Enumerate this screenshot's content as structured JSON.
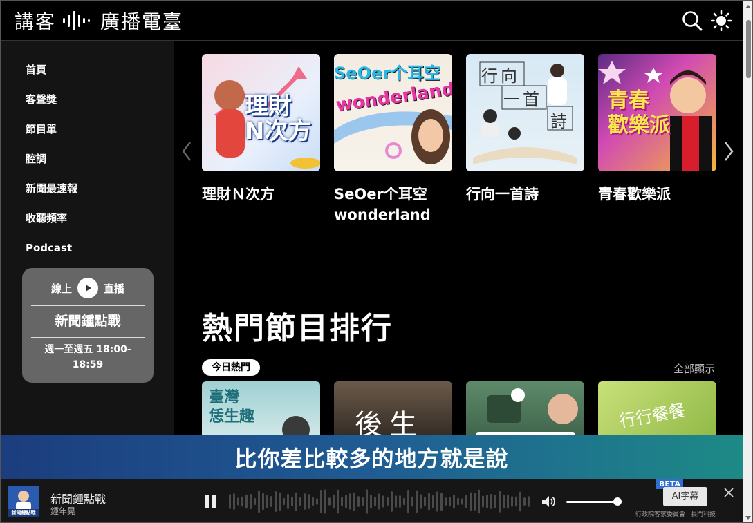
{
  "header": {
    "logo_left": "講客",
    "logo_right": "廣播電臺"
  },
  "sidebar": {
    "items": [
      {
        "label": "首頁"
      },
      {
        "label": "客聲獎"
      },
      {
        "label": "節目單"
      },
      {
        "label": "腔調"
      },
      {
        "label": "新聞最速報"
      },
      {
        "label": "收聽頻率"
      },
      {
        "label": "Podcast"
      }
    ],
    "live": {
      "left": "線上",
      "right": "直播",
      "show": "新聞鍾點戰",
      "time": "週一至週五 18:00-18:59"
    }
  },
  "carousel": {
    "items": [
      {
        "title": "理財Ｎ次方",
        "art": "理財\nN次方"
      },
      {
        "title": "SeOer个耳空 wonderland",
        "art_a": "SeOer个耳空",
        "art_b": "wonderland"
      },
      {
        "title": "行向一首詩",
        "art_a": "行向",
        "art_b": "一首",
        "art_c": "詩"
      },
      {
        "title": "青春歡樂派",
        "art": "青春\n歡樂派"
      }
    ]
  },
  "hot": {
    "title": "熱門節目排行",
    "tab": "今日熱門",
    "show_all": "全部顯示",
    "items": [
      {
        "art": "臺灣\n恁生趣"
      },
      {
        "art": "後生"
      },
      {
        "art": ""
      },
      {
        "art": "行行餐餐"
      }
    ]
  },
  "subtitle": "比你差比較多的地方就是說",
  "player": {
    "show": "新聞鍾點戰",
    "host": "鍾年晃",
    "thumb_label": "新聞鍾點戰",
    "beta": "BETA",
    "ai_label": "AI字幕",
    "sponsor_a": "行政院客家委員會",
    "sponsor_b": "長門科技",
    "volume": 0.9
  },
  "colors": {
    "background": "#000000",
    "sidebar": "#141414",
    "live_card": "#666666",
    "subtitle_start": "#1c3d7d",
    "subtitle_end": "#1d8a86"
  }
}
